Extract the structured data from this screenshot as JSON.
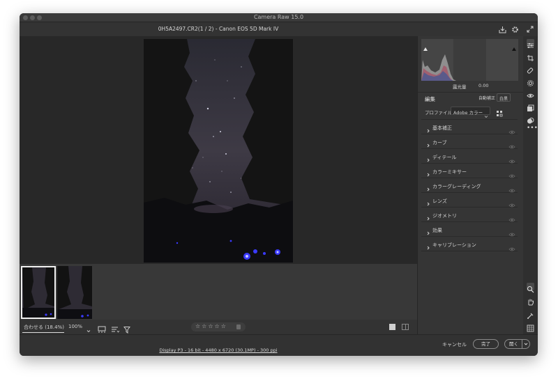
{
  "app": {
    "title": "Camera Raw 15.0"
  },
  "header": {
    "file_title": "0H5A2497.CR2(1 / 2)  -  Canon EOS 5D Mark IV"
  },
  "histogram": {
    "label": "露光量",
    "value": "0.00"
  },
  "panel": {
    "edit_label": "編集",
    "auto_button": "自動補正",
    "bw_button": "白黒",
    "profile_label": "プロファイル",
    "profile_value": "Adobe カラー",
    "sections": [
      {
        "label": "基本補正"
      },
      {
        "label": "カーブ"
      },
      {
        "label": "ディテール"
      },
      {
        "label": "カラーミキサー"
      },
      {
        "label": "カラーグレーディング"
      },
      {
        "label": "レンズ"
      },
      {
        "label": "ジオメトリ"
      },
      {
        "label": "効果"
      },
      {
        "label": "キャリブレーション"
      }
    ]
  },
  "bottombar": {
    "fit_label": "合わせる (18.4%)",
    "zoom_label": "100%",
    "stars": [
      "☆",
      "☆",
      "☆",
      "☆",
      "☆"
    ]
  },
  "statusbar": {
    "info": "Display P3 - 16 bit - 4480 x 6720 (30.1MP) - 300 ppi",
    "cancel": "キャンセル",
    "done": "完了",
    "open": "開く"
  },
  "colors": {
    "window_bg": "#2e2e2e",
    "panel_bg": "#353535",
    "canvas_bg": "#282828"
  }
}
